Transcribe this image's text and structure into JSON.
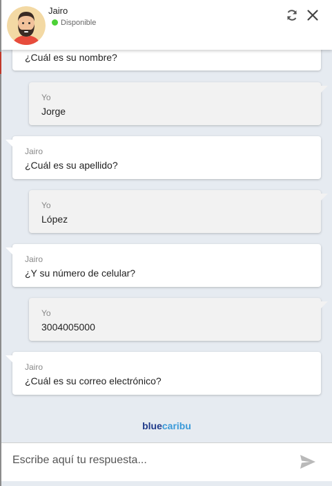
{
  "header": {
    "agent_name": "Jairo",
    "status": "Disponible",
    "status_color": "#4cd137",
    "refresh_icon": "refresh-icon",
    "close_icon": "close-icon"
  },
  "messages": [
    {
      "sender": "",
      "text": "¿Cuál es su nombre?",
      "from": "agent"
    },
    {
      "sender": "Yo",
      "text": "Jorge",
      "from": "user"
    },
    {
      "sender": "Jairo",
      "text": "¿Cuál es su apellido?",
      "from": "agent"
    },
    {
      "sender": "Yo",
      "text": "López",
      "from": "user"
    },
    {
      "sender": "Jairo",
      "text": "¿Y su número de celular?",
      "from": "agent"
    },
    {
      "sender": "Yo",
      "text": "3004005000",
      "from": "user"
    },
    {
      "sender": "Jairo",
      "text": "¿Cuál es su correo electrónico?",
      "from": "agent"
    }
  ],
  "brand": {
    "part1": "blue",
    "part2": "caribu",
    "color1": "#1f3a8a",
    "color2": "#3a9ad9"
  },
  "composer": {
    "placeholder": "Escribe aquí tu respuesta...",
    "value": "",
    "send_icon": "send-icon"
  },
  "colors": {
    "background": "#e6ebf1",
    "agent_bubble": "#ffffff",
    "user_bubble": "#f2f2f2"
  }
}
